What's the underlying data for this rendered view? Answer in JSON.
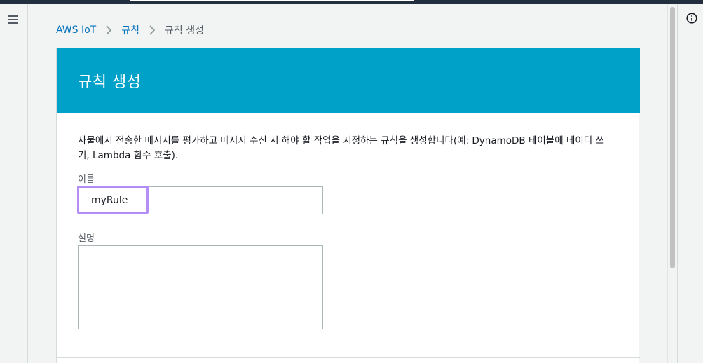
{
  "breadcrumb": {
    "items": [
      {
        "label": "AWS IoT"
      },
      {
        "label": "규칙"
      },
      {
        "label": "규칙 생성"
      }
    ]
  },
  "page": {
    "title": "규칙 생성",
    "description": "사물에서 전송한 메시지를 평가하고 메시지 수신 시 해야 할 작업을 지정하는 규칙을 생성합니다(예: DynamoDB 테이블에 데이터 쓰기, Lambda 함수 호출)."
  },
  "form": {
    "name_label": "이름",
    "name_value": "myRule",
    "description_label": "설명",
    "description_value": ""
  },
  "icons": {
    "menu": "hamburger-menu-icon",
    "chevron": "chevron-right-icon",
    "info": "info-icon"
  },
  "colors": {
    "header_bg": "#00a1c9",
    "link": "#0073bb",
    "highlight": "#b48ef5",
    "topbar": "#232f3e"
  }
}
